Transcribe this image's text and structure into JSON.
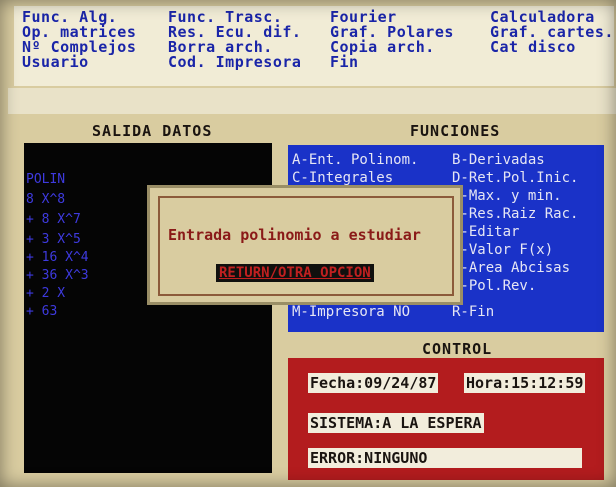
{
  "menu": {
    "col1": [
      "Func. Alg.",
      "Op. matrices",
      "Nº Complejos",
      "Usuario"
    ],
    "col2": [
      "Func. Trasc.",
      "Res. Ecu. dif.",
      "Borra arch.",
      "Cod. Impresora"
    ],
    "col3": [
      "Fourier",
      "Graf. Polares",
      "Copia arch.",
      "Fin"
    ],
    "col4": [
      "Calculadora",
      "Graf. cartes.",
      "Cat disco"
    ]
  },
  "output": {
    "title": "SALIDA DATOS",
    "lines": [
      "POLIN",
      "  8 X^8",
      "+ 8 X^7",
      "+ 3 X^5",
      "+ 16 X^4",
      "+ 36 X^3",
      "+ 2 X",
      "+ 63"
    ]
  },
  "functions": {
    "title": "FUNCIONES",
    "left": [
      "A-Ent. Polinom.",
      "C-Integrales",
      "",
      "",
      "",
      "",
      "",
      "",
      "M-Impresora NO"
    ],
    "right": [
      "B-Derivadas",
      "D-Ret.Pol.Inic.",
      "F-Max. y min.",
      "H-Res.Raiz Rac.",
      "J-Editar",
      "L-Valor F(x)",
      "N-Area Abcisas",
      "P-Pol.Rev.",
      "R-Fin"
    ]
  },
  "control": {
    "title": "CONTROL",
    "fecha": "Fecha:09/24/87",
    "hora": "Hora:15:12:59",
    "sistema": "SISTEMA:A LA ESPERA",
    "error": "ERROR:NINGUNO"
  },
  "dialog": {
    "prompt": "Entrada polinomio a estudiar",
    "button": "RETURN/OTRA OPCION"
  },
  "colors": {
    "menu_text": "#1a25a8",
    "output_bg": "#050505",
    "output_text": "#3e3adf",
    "functions_bg": "#1a32c8",
    "control_bg": "#b31c1e",
    "screen_bg": "#d9cca0"
  }
}
